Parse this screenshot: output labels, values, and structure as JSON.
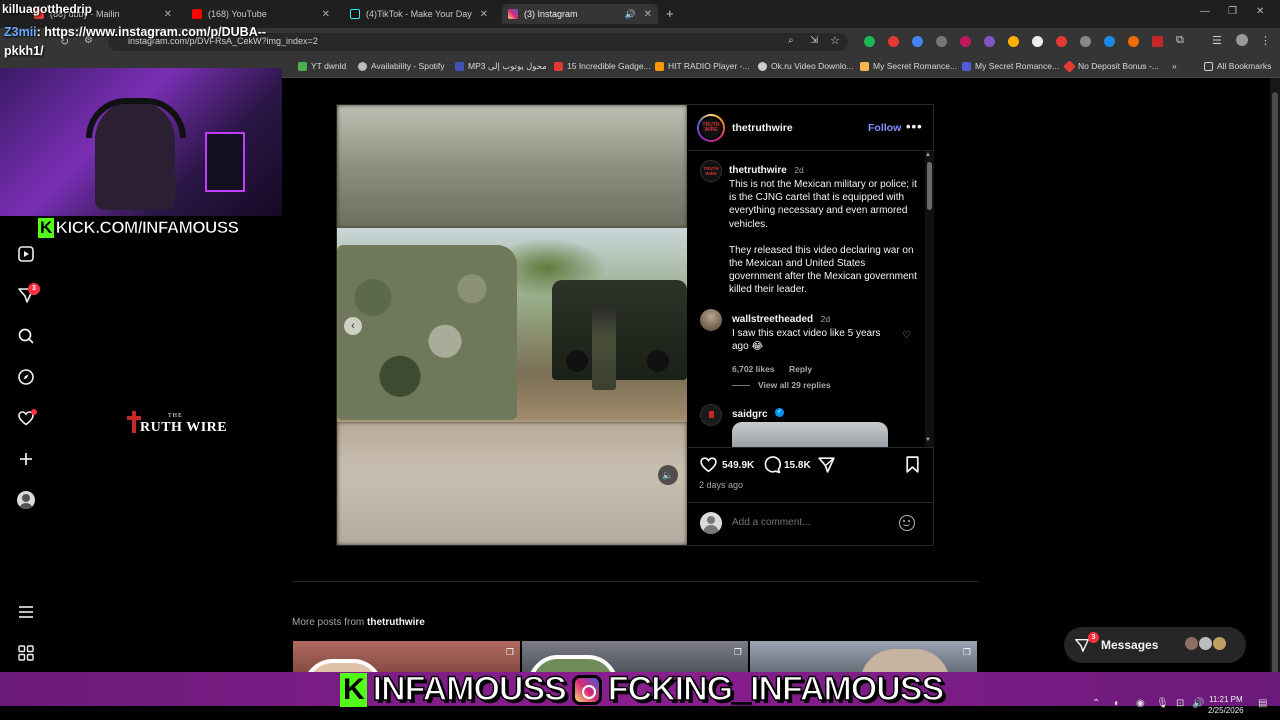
{
  "browser": {
    "tabs": [
      {
        "label": "(88) ubby - Mailin",
        "icon_color": "#e53935"
      },
      {
        "label": "(168) YouTube",
        "icon_color": "#ff0000"
      },
      {
        "label": "(4)TikTok - Make Your Day",
        "icon_color": "#111111"
      },
      {
        "label": "(3) Instagram",
        "icon_color": "#d62976"
      }
    ],
    "url": "instagram.com/p/DVFRsA_CekW?img_index=2",
    "bookmarks": [
      {
        "label": "YT dwnld",
        "icon_color": "#4caf50"
      },
      {
        "label": "Availability - Spotify",
        "icon_color": "#bbbbbb"
      },
      {
        "label": "MP3 محول يوتوب إلى",
        "icon_color": "#3f51b5"
      },
      {
        "label": "15 Incredible Gadge...",
        "icon_color": "#e53935"
      },
      {
        "label": "HIT RADIO Player -...",
        "icon_color": "#ff9800"
      },
      {
        "label": "Ok.ru Video Downlo...",
        "icon_color": "#cccccc"
      },
      {
        "label": "My Secret Romance...",
        "icon_color": "#ffb74d"
      },
      {
        "label": "My Secret Romance...",
        "icon_color": "#4f5bd5"
      },
      {
        "label": "No Deposit Bonus -...",
        "icon_color": "#e53935"
      }
    ],
    "all_bookmarks": "All Bookmarks",
    "more_bookmarks": "»"
  },
  "stream": {
    "streamer": "killuagotthedrip",
    "chat_user": "Z3mii",
    "chat_message": ": https://www.instagram.com/p/DUBA--",
    "chat_message_2": "pkkh1/",
    "kick_handle": "KICK.COM/INFAMOUSS",
    "kick_letter": "K",
    "banner_kick": "INFAMOUSS",
    "banner_ig": "FCKING_INFAMOUSS"
  },
  "sidebar": {
    "notifications_badge": "3"
  },
  "post": {
    "username": "thetruthwire",
    "avatar_text": "TRUTH WIRE",
    "follow_label": "Follow",
    "more_label": "•••",
    "watermark_small": "THE",
    "watermark": "RUTH WIRE",
    "caption": {
      "username": "thetruthwire",
      "time": "2d",
      "paragraph1": "This is not the Mexican military or police; it is the CJNG cartel that is equipped with everything necessary and even armored vehicles.",
      "paragraph2": "They released this video declaring war on the Mexican and United States government after the Mexican government killed their leader."
    },
    "comments": [
      {
        "username": "wallstreetheaded",
        "time": "2d",
        "text": "I saw this exact video like 5 years ago 😂",
        "likes": "6,702 likes",
        "reply_label": "Reply",
        "view_replies": "View all 29 replies"
      },
      {
        "username": "saidgrc",
        "verified": true
      }
    ],
    "likes": "549.9K",
    "comments_count": "15.8K",
    "posted_ago": "2 days ago",
    "comment_placeholder": "Add a comment..."
  },
  "more_posts": {
    "label_prefix": "More posts from",
    "label_user": "thetruthwire"
  },
  "messages": {
    "label": "Messages",
    "badge": "3"
  },
  "taskbar": {
    "time": "11:21 PM",
    "date": "2/25/2026"
  }
}
